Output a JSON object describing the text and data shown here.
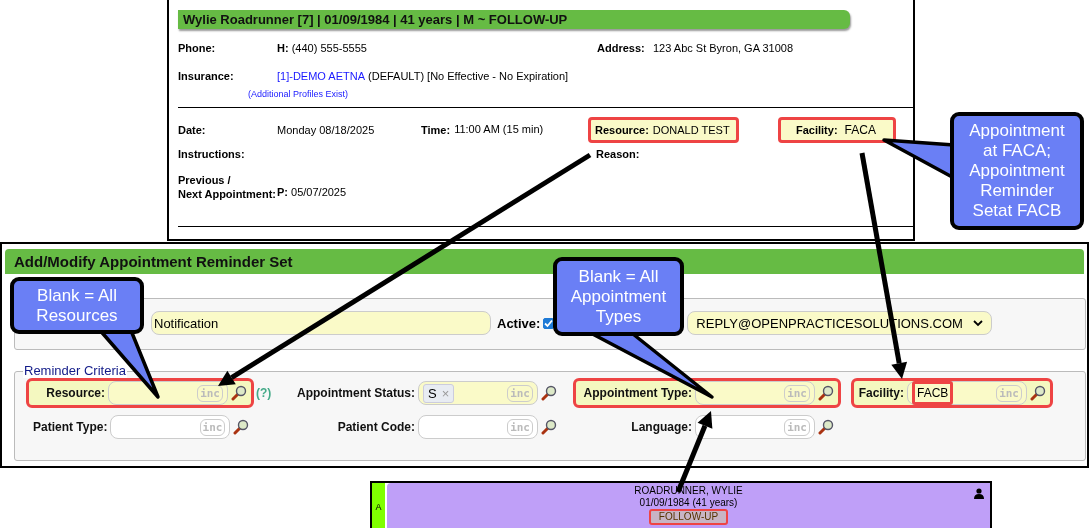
{
  "patient_panel": {
    "title": "Wylie Roadrunner [7] | 01/09/1984 | 41 years | M  ~  FOLLOW-UP",
    "phone_label": "Phone:",
    "phone_value": "**H:** (440) 555-5555",
    "address_label": "Address:",
    "address_value": "123 Abc St Byron, GA 31008",
    "insurance_label": "Insurance:",
    "insurance_link": "[1]-DEMO AETNA",
    "insurance_detail": "(DEFAULT) [No Effective - No Expiration]",
    "additional_profiles": "(Additional Profiles Exist)",
    "date_label": "Date:",
    "date_value": "Monday 08/18/2025",
    "time_label": "Time:",
    "time_value": "11:00 AM (15 min)",
    "resource_label": "Resource:",
    "resource_value": "DONALD TEST",
    "resource_highlighted": true,
    "facility_label": "Facility:",
    "facility_value": "FACA",
    "facility_highlighted": true,
    "instructions_label": "Instructions:",
    "reason_label": "Reason:",
    "previous_label": "Previous /\nNext Appointment:",
    "previous_value": "**P:** 05/07/2025"
  },
  "reminder_form": {
    "title": "Add/Modify Appointment Reminder Set",
    "name_value": "Notification",
    "active_label": "Active:",
    "active_checked": true,
    "sender_value": "REPLY@OPENPRACTICESOLUTIONS.COM",
    "criteria_legend": "Reminder Criteria",
    "rows": [
      [
        {
          "label": "Resource:",
          "inc": "inc",
          "tinted": true,
          "highlighted": true,
          "help": "(?)"
        },
        {
          "label": "Appointment Status:",
          "chip": "S",
          "chip_remove": "×",
          "inc": "inc",
          "tinted": true,
          "highlighted": false
        },
        {
          "label": "Appointment Type:",
          "inc": "inc",
          "tinted": true,
          "highlighted": true
        },
        {
          "label": "Facility:",
          "value": "FACB",
          "value_highlighted": true,
          "inc": "inc",
          "tinted": true,
          "highlighted": true
        }
      ],
      [
        {
          "label": "Patient Type:",
          "inc": "inc",
          "tinted": false,
          "highlighted": false
        },
        {
          "label": "Patient Code:",
          "inc": "inc",
          "tinted": false,
          "highlighted": false
        },
        {
          "label": "Language:",
          "inc": "inc",
          "tinted": false,
          "highlighted": false
        }
      ]
    ]
  },
  "schedule_card": {
    "status_letter": "A",
    "name": "ROADRUNNER, WYLIE",
    "birth": "01/09/1984 (41 years)",
    "type": "FOLLOW-UP",
    "type_highlighted": true
  },
  "callouts": [
    {
      "text": "Blank = All Resources"
    },
    {
      "text": "Blank = All Appointment Types"
    },
    {
      "text": "Appointment at FACA; Appointment Reminder Setat FACB"
    }
  ]
}
